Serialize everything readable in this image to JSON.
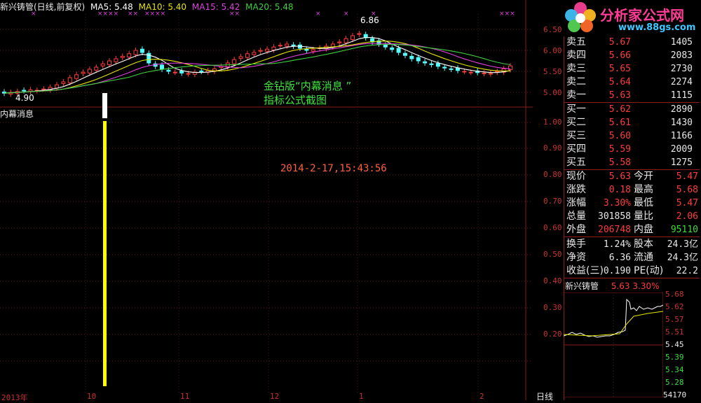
{
  "header": {
    "title": "新兴铸管(日线,前复权)",
    "ma5": "MA5: 5.48",
    "ma10": "MA10: 5.40",
    "ma15": "MA15: 5.42",
    "ma20": "MA20: 5.48",
    "colors": {
      "ma5": "#ffffff",
      "ma10": "#e6e600",
      "ma15": "#e040e0",
      "ma20": "#40d040"
    }
  },
  "logo": {
    "text": "分析家公式网",
    "url": "www.88gs.com"
  },
  "main_chart": {
    "high_label": "6.86",
    "low_label": "4.90",
    "y_ticks": [
      "6.50",
      "6.00",
      "5.50",
      "5.00"
    ],
    "candle_closes": [
      4.98,
      5.0,
      5.02,
      5.04,
      5.06,
      5.05,
      5.08,
      5.12,
      5.18,
      5.25,
      5.35,
      5.42,
      5.48,
      5.55,
      5.6,
      5.68,
      5.75,
      5.8,
      5.86,
      5.92,
      6.0,
      5.95,
      5.7,
      5.62,
      5.55,
      5.5,
      5.48,
      5.46,
      5.45,
      5.48,
      5.5,
      5.52,
      5.56,
      5.62,
      5.7,
      5.78,
      5.85,
      5.92,
      5.95,
      6.0,
      6.03,
      6.08,
      6.12,
      6.15,
      6.1,
      6.05,
      6.0,
      6.02,
      6.06,
      6.1,
      6.15,
      6.2,
      6.28,
      6.35,
      6.4,
      6.3,
      6.2,
      6.15,
      6.08,
      6.02,
      5.95,
      5.88,
      5.8,
      5.75,
      5.7,
      5.66,
      5.62,
      5.58,
      5.55,
      5.52,
      5.5,
      5.48,
      5.47,
      5.46,
      5.45,
      5.5,
      5.56,
      5.63
    ],
    "annotation": [
      "金钻版“内幕消息 ”",
      "指标公式截图"
    ],
    "annotation_color": "#40e040"
  },
  "indicator": {
    "name": "内幕消息",
    "y_ticks": [
      "1.00",
      "0.90",
      "0.80",
      "0.70",
      "0.60",
      "0.50",
      "0.40",
      "0.30",
      "0.20"
    ],
    "timestamp": "2014-2-17,15:43:56",
    "timestamp_color": "#ff6040",
    "bar_color": "#ffff00",
    "bar_value": 1.0
  },
  "x_axis": {
    "labels": [
      "2013年",
      "10",
      "11",
      "12",
      "1",
      "2"
    ],
    "period_label": "日线"
  },
  "order_book": {
    "sell": [
      {
        "label": "卖五",
        "price": "5.67",
        "vol": "1405"
      },
      {
        "label": "卖四",
        "price": "5.66",
        "vol": "2083"
      },
      {
        "label": "卖三",
        "price": "5.65",
        "vol": "2730"
      },
      {
        "label": "卖二",
        "price": "5.64",
        "vol": "2274"
      },
      {
        "label": "卖一",
        "price": "5.63",
        "vol": "1115"
      }
    ],
    "buy": [
      {
        "label": "买一",
        "price": "5.62",
        "vol": "2890"
      },
      {
        "label": "买二",
        "price": "5.61",
        "vol": "1430"
      },
      {
        "label": "买三",
        "price": "5.60",
        "vol": "1166"
      },
      {
        "label": "买四",
        "price": "5.59",
        "vol": "2009"
      },
      {
        "label": "买五",
        "price": "5.58",
        "vol": "1275"
      }
    ]
  },
  "quote": {
    "rows": [
      {
        "k1": "现价",
        "v1": "5.63",
        "c1": "red",
        "k2": "今开",
        "v2": "5.47",
        "c2": "red"
      },
      {
        "k1": "涨跌",
        "v1": "0.18",
        "c1": "red",
        "k2": "最高",
        "v2": "5.68",
        "c2": "red"
      },
      {
        "k1": "涨幅",
        "v1": "3.30%",
        "c1": "red",
        "k2": "最低",
        "v2": "5.47",
        "c2": "red"
      },
      {
        "k1": "总量",
        "v1": "301858",
        "c1": "wht",
        "k2": "量比",
        "v2": "2.06",
        "c2": "red"
      },
      {
        "k1": "外盘",
        "v1": "206748",
        "c1": "red",
        "k2": "内盘",
        "v2": "95110",
        "c2": "grn"
      }
    ],
    "rows2": [
      {
        "k1": "换手",
        "v1": "1.24%",
        "c1": "wht",
        "k2": "股本",
        "v2": "24.3亿",
        "c2": "wht"
      },
      {
        "k1": "净资",
        "v1": "6.36",
        "c1": "wht",
        "k2": "流通",
        "v2": "24.3亿",
        "c2": "wht"
      },
      {
        "k1": "收益(三)",
        "v1": "0.190",
        "c1": "wht",
        "k2": "PE(动)",
        "v2": "22.2",
        "c2": "wht"
      }
    ]
  },
  "mini_chart": {
    "title": "新兴铸管",
    "price": "5.63",
    "pct": "3.30%",
    "right_ticks_red": [
      "5.68",
      "5.62",
      "5.57",
      "5.51"
    ],
    "right_ticks_white": [
      "5.45"
    ],
    "right_ticks_green": [
      "5.39",
      "5.34",
      "5.28"
    ],
    "volume_label": "54170"
  }
}
